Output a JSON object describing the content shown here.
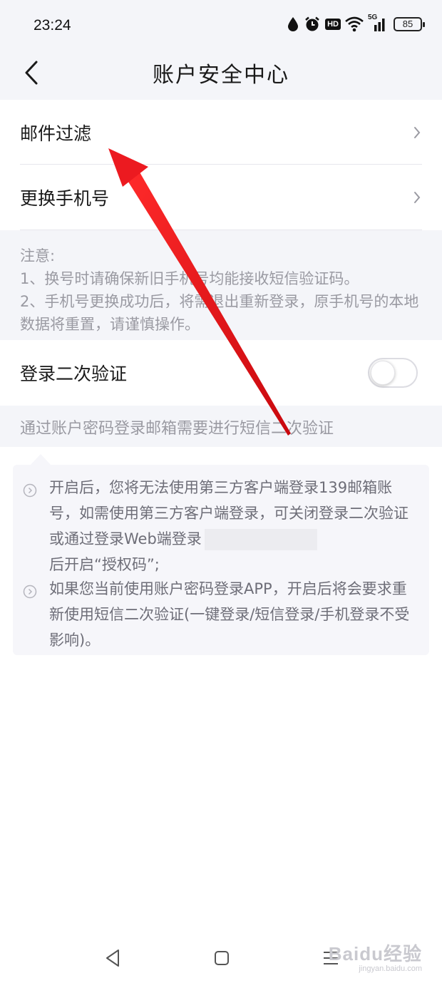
{
  "status_bar": {
    "time": "23:24",
    "hd_label": "HD",
    "signal_label": "5G",
    "battery": "85"
  },
  "header": {
    "title": "账户安全中心"
  },
  "menu": {
    "mail_filter": "邮件过滤",
    "change_phone": "更换手机号"
  },
  "notice": {
    "title": "注意:",
    "line1": "1、换号时请确保新旧手机号均能接收短信验证码。",
    "line2": "2、手机号更换成功后，将需退出重新登录，原手机号的本地数据将重置，请谨慎操作。"
  },
  "two_factor": {
    "label": "登录二次验证",
    "enabled": false,
    "description": "通过账户密码登录邮箱需要进行短信二次验证"
  },
  "tips": {
    "item1_text": "开启后，您将无法使用第三方客户端登录139邮箱账号，如需使用第三方客户端登录，可关闭登录二次验证或通过登录Web端登录",
    "item1_tail": "后开启“授权码”;",
    "item2_text": "如果您当前使用账户密码登录APP，开启后将会要求重新使用短信二次验证(一键登录/短信登录/手机登录不受影响)。"
  },
  "watermark": {
    "main": "Baidu经验",
    "sub": "jingyan.baidu.com"
  },
  "colors": {
    "page_bg": "#f4f5f9",
    "annotation_arrow": "#e8161c",
    "muted_text": "#9a9aa2"
  },
  "icons": {
    "back": "chevron-left-icon",
    "row_chevron": "chevron-right-icon",
    "tip_bullet": "circle-chevron-icon"
  }
}
